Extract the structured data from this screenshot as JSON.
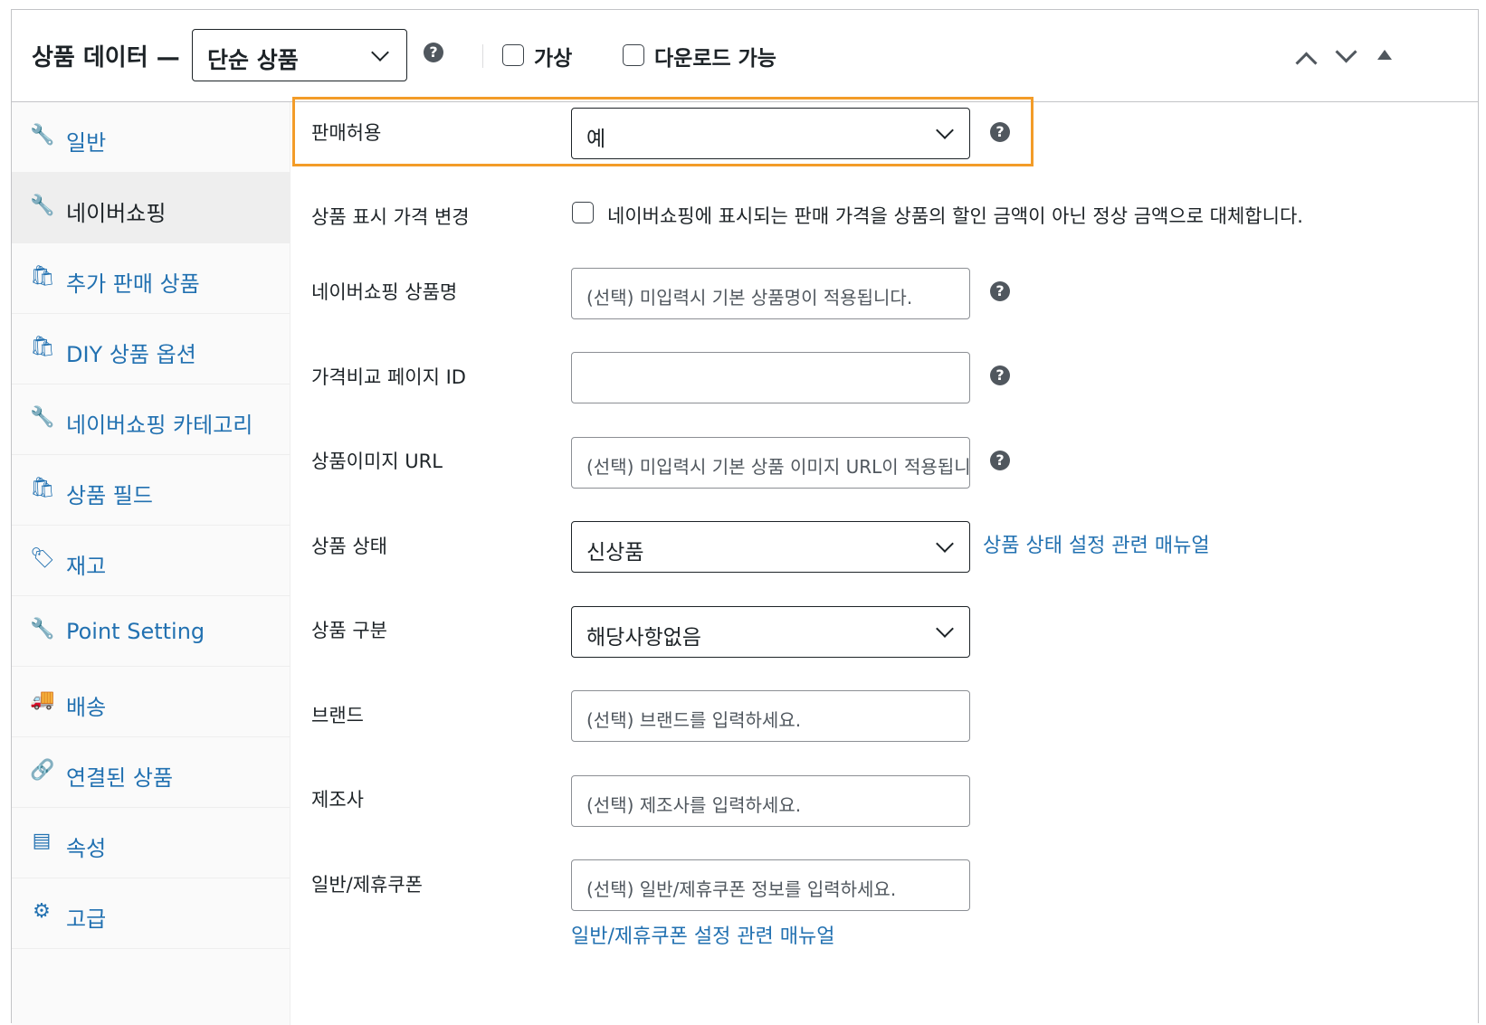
{
  "header": {
    "title": "상품 데이터 —",
    "product_type": "단순 상품",
    "virtual_label": "가상",
    "downloadable_label": "다운로드 가능"
  },
  "sidebar": {
    "items": [
      {
        "label": "일반",
        "icon": "wrench-icon",
        "active": false
      },
      {
        "label": "네이버쇼핑",
        "icon": "wrench-icon",
        "active": true
      },
      {
        "label": "추가 판매 상품",
        "icon": "shopping-bag-icon",
        "active": false
      },
      {
        "label": "DIY 상품 옵션",
        "icon": "shopping-bag-icon",
        "active": false
      },
      {
        "label": "네이버쇼핑 카테고리",
        "icon": "wrench-icon",
        "active": false
      },
      {
        "label": "상품 필드",
        "icon": "shopping-bag-icon",
        "active": false
      },
      {
        "label": "재고",
        "icon": "tag-icon",
        "active": false
      },
      {
        "label": "Point Setting",
        "icon": "wrench-icon",
        "active": false
      },
      {
        "label": "배송",
        "icon": "truck-icon",
        "active": false
      },
      {
        "label": "연결된 상품",
        "icon": "link-icon",
        "active": false
      },
      {
        "label": "속성",
        "icon": "list-icon",
        "active": false
      },
      {
        "label": "고급",
        "icon": "gear-icon",
        "active": false
      }
    ]
  },
  "fields": {
    "sale_allowed": {
      "label": "판매허용",
      "value": "예"
    },
    "price_display": {
      "label": "상품 표시 가격 변경",
      "checkbox_text": "네이버쇼핑에 표시되는 판매 가격을 상품의 할인 금액이 아닌 정상 금액으로 대체합니다."
    },
    "naver_name": {
      "label": "네이버쇼핑 상품명",
      "placeholder": "(선택) 미입력시 기본 상품명이 적용됩니다."
    },
    "compare_id": {
      "label": "가격비교 페이지 ID",
      "value": ""
    },
    "image_url": {
      "label": "상품이미지 URL",
      "placeholder": "(선택) 미입력시 기본 상품 이미지 URL이 적용됩니다."
    },
    "condition": {
      "label": "상품 상태",
      "value": "신상품",
      "manual_link": "상품 상태 설정 관련 매뉴얼"
    },
    "category_type": {
      "label": "상품 구분",
      "value": "해당사항없음"
    },
    "brand": {
      "label": "브랜드",
      "placeholder": "(선택) 브랜드를 입력하세요."
    },
    "maker": {
      "label": "제조사",
      "placeholder": "(선택) 제조사를 입력하세요."
    },
    "coupon": {
      "label": "일반/제휴쿠폰",
      "placeholder": "(선택) 일반/제휴쿠폰 정보를 입력하세요.",
      "manual_link": "일반/제휴쿠폰 설정 관련 매뉴얼"
    }
  },
  "colors": {
    "link": "#2271b1",
    "highlight": "#f39c28"
  }
}
